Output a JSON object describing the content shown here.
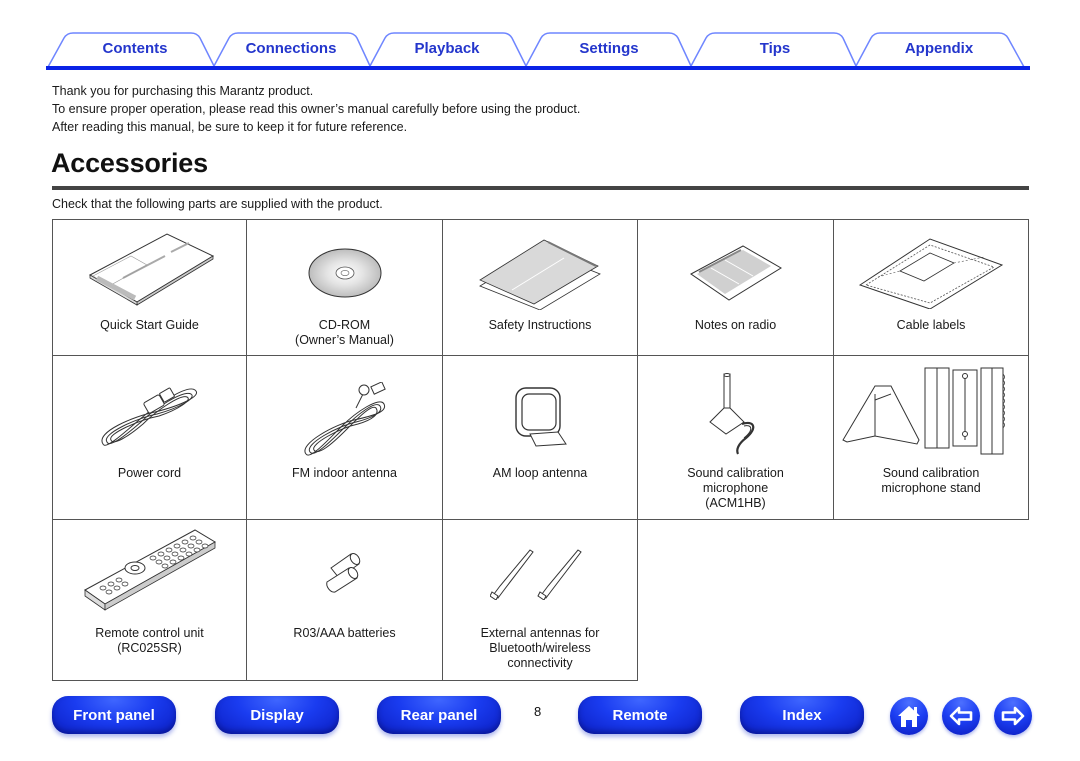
{
  "tabs": [
    {
      "label": "Contents"
    },
    {
      "label": "Connections"
    },
    {
      "label": "Playback"
    },
    {
      "label": "Settings"
    },
    {
      "label": "Tips"
    },
    {
      "label": "Appendix"
    }
  ],
  "intro": {
    "lines": [
      "Thank you for purchasing this Marantz product.",
      "To ensure proper operation, please read this owner’s manual carefully before using the product.",
      "After reading this manual, be sure to keep it for future reference."
    ]
  },
  "section": {
    "title": "Accessories",
    "check_text": "Check that the following parts are supplied with the product."
  },
  "accessories": [
    {
      "label": "Quick Start Guide",
      "icon": "quick-start-guide-icon"
    },
    {
      "label": "CD-ROM\n(Owner’s Manual)",
      "icon": "cd-rom-icon"
    },
    {
      "label": "Safety Instructions",
      "icon": "safety-instructions-icon"
    },
    {
      "label": "Notes on radio",
      "icon": "notes-on-radio-icon"
    },
    {
      "label": "Cable labels",
      "icon": "cable-labels-icon"
    },
    {
      "label": "Power cord",
      "icon": "power-cord-icon"
    },
    {
      "label": "FM indoor antenna",
      "icon": "fm-antenna-icon"
    },
    {
      "label": "AM loop antenna",
      "icon": "am-loop-antenna-icon"
    },
    {
      "label": "Sound calibration\nmicrophone\n(ACM1HB)",
      "icon": "microphone-icon"
    },
    {
      "label": "Sound calibration\nmicrophone stand",
      "icon": "microphone-stand-icon"
    },
    {
      "label": "Remote control unit\n(RC025SR)",
      "icon": "remote-control-icon"
    },
    {
      "label": "R03/AAA batteries",
      "icon": "batteries-icon"
    },
    {
      "label": "External antennas for\nBluetooth/wireless\nconnectivity",
      "icon": "external-antennas-icon"
    }
  ],
  "footer": {
    "buttons": {
      "front_panel": "Front panel",
      "display": "Display",
      "rear_panel": "Rear panel",
      "remote": "Remote",
      "index": "Index"
    },
    "page_number": "8",
    "icons": [
      "home-icon",
      "back-arrow-icon",
      "forward-arrow-icon"
    ]
  },
  "colors": {
    "accent": "#0a23e6",
    "tab_text": "#2436cc",
    "tab_outline": "#6f86ff"
  }
}
